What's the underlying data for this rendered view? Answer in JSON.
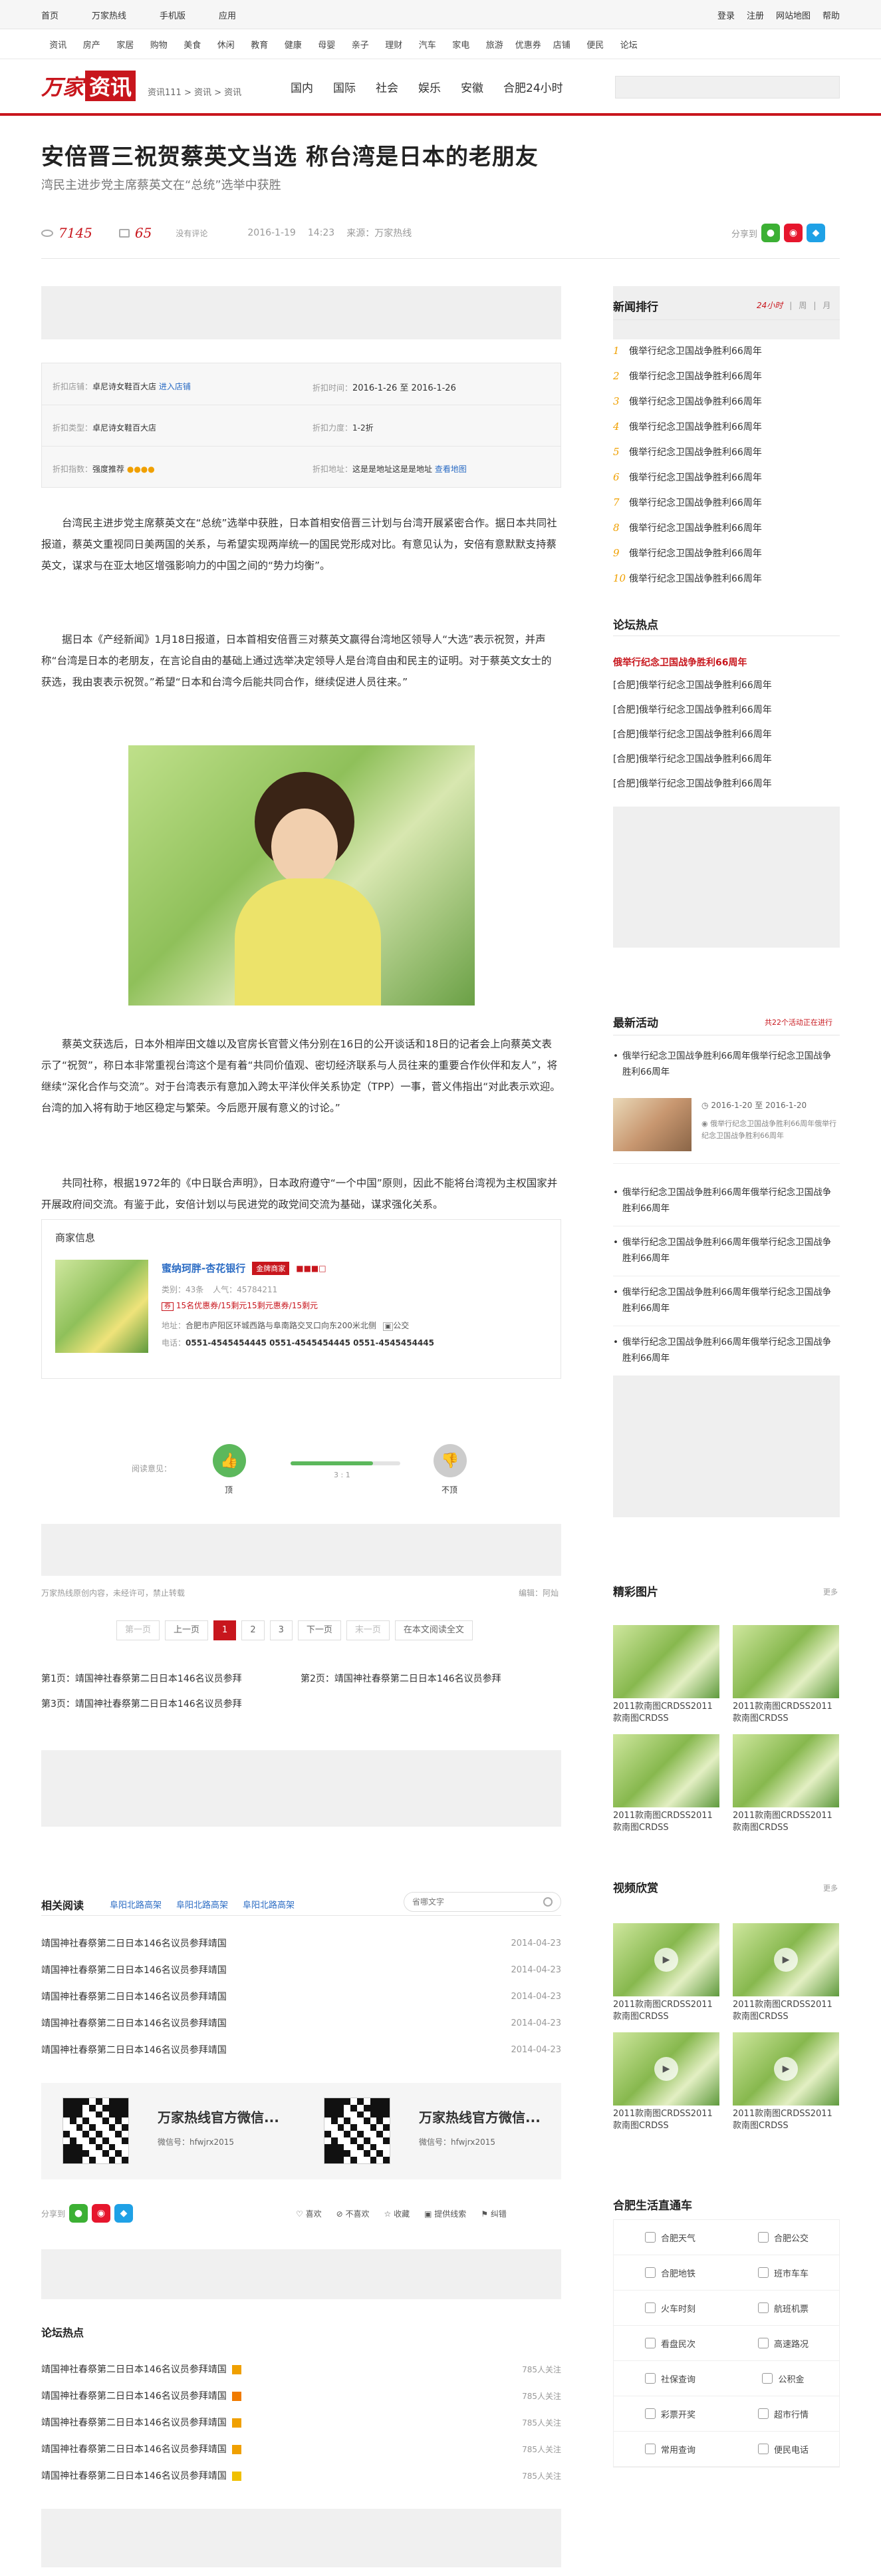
{
  "topbar": {
    "links": [
      "首页",
      "万家热线",
      "手机版",
      "应用"
    ],
    "right": [
      "登录",
      "注册",
      "网站地图",
      "帮助"
    ]
  },
  "channels": [
    "资讯",
    "房产",
    "家居",
    "购物",
    "美食",
    "休闲",
    "教育",
    "健康",
    "母婴",
    "亲子",
    "理财",
    "汽车",
    "家电",
    "旅游",
    "优惠券",
    "店铺",
    "便民",
    "论坛"
  ],
  "header": {
    "logo_a": "万家",
    "logo_b": "资讯",
    "crumb": "资讯111 > 资讯 > 资讯",
    "nav": [
      "国内",
      "国际",
      "社会",
      "娱乐",
      "安徽",
      "合肥24小时"
    ]
  },
  "article": {
    "title": "安倍晋三祝贺蔡英文当选 称台湾是日本的老朋友",
    "subtitle": "湾民主进步党主席蔡英文在“总统”选举中获胜",
    "views": "7145",
    "comments": "65",
    "comment_label": "没有评论",
    "date": "2016-1-19",
    "time": "14:23",
    "source": "来源：万家热线",
    "share_label": "分享到",
    "info": {
      "store_k": "折扣店铺：",
      "store_v": "卓尼诗女鞋百大店",
      "store_link": "进入店铺",
      "time_k": "折扣时间：",
      "time_v": "2016-1-26 至 2016-1-26",
      "type_k": "折扣类型：",
      "type_v": "卓尼诗女鞋百大店",
      "power_k": "折扣力度：",
      "power_v": "1-2折",
      "level_k": "折扣指数：",
      "level_v": "强度推荐",
      "addr_k": "折扣地址：",
      "addr_v": "这是是地址这是是地址",
      "map_link": "查看地图"
    },
    "p1": "台湾民主进步党主席蔡英文在“总统”选举中获胜，日本首相安倍晋三计划与台湾开展紧密合作。据日本共同社报道，蔡英文重视同日美两国的关系，与希望实现两岸统一的国民党形成对比。有意见认为，安倍有意默默支持蔡英文，谋求与在亚太地区增强影响力的中国之间的“势力均衡”。",
    "p2": "据日本《产经新闻》1月18日报道，日本首相安倍晋三对蔡英文赢得台湾地区领导人“大选”表示祝贺，并声称“台湾是日本的老朋友，在言论自由的基础上通过选举决定领导人是台湾自由和民主的证明。对于蔡英文女士的获选，我由衷表示祝贺。”希望“日本和台湾今后能共同合作，继续促进人员往来。”",
    "p3": "蔡英文获选后，日本外相岸田文雄以及官房长官菅义伟分别在16日的公开谈话和18日的记者会上向蔡英文表示了“祝贺”，称日本非常重视台湾这个是有着“共同价值观、密切经济联系与人员往来的重要合作伙伴和友人”，将继续“深化合作与交流”。对于台湾表示有意加入跨太平洋伙伴关系协定（TPP）一事，菅义伟指出“对此表示欢迎。台湾的加入将有助于地区稳定与繁荣。今后愿开展有意义的讨论。”",
    "p4": "共同社称，根据1972年的《中日联合声明》，日本政府遵守“一个中国”原则，因此不能将台湾视为主权国家并开展政府间交流。有鉴于此，安倍计划以与民进党的政党间交流为基础，谋求强化关系。"
  },
  "merchant": {
    "heading": "商家信息",
    "name": "蜜纳珂胖-杏花银行",
    "badge": "金牌商家",
    "cat_k": "类别：",
    "cat_v": "43条",
    "pop_k": "人气：",
    "pop_v": "45784211",
    "discount": "15名优惠券/15剩元15剩元惠券/15剩元",
    "addr_k": "地址：",
    "addr_v": "合肥市庐阳区环城西路与阜南路交叉口向东200米北侧",
    "bus": "公交",
    "tel_k": "电话：",
    "tel_v": "0551-4545454445 0551-4545454445 0551-4545454445"
  },
  "rating": {
    "label": "阅读意见：",
    "up": "顶",
    "down": "不顶",
    "ratio": "3 : 1",
    "up_share": 0.75
  },
  "note": {
    "left": "万家热线原创内容，未经许可，禁止转载",
    "editor": "编辑：阿灿"
  },
  "pager": {
    "first": "第一页",
    "prev": "上一页",
    "pages": [
      "1",
      "2",
      "3"
    ],
    "next": "下一页",
    "last": "末一页",
    "all": "在本文阅读全文"
  },
  "pagelinks": [
    "第1页：靖国神社春祭第二日日本146名议员参拜",
    "第2页：靖国神社春祭第二日日本146名议员参拜",
    "第3页：靖国神社春祭第二日日本146名议员参拜"
  ],
  "related": {
    "title": "相关阅读",
    "tags": [
      "阜阳北路高架",
      "阜阳北路高架",
      "阜阳北路高架"
    ],
    "search_placeholder": "省哪文字",
    "items": [
      {
        "t": "靖国神社春祭第二日日本146名议员参拜靖国",
        "d": "2014-04-23"
      },
      {
        "t": "靖国神社春祭第二日日本146名议员参拜靖国",
        "d": "2014-04-23"
      },
      {
        "t": "靖国神社春祭第二日日本146名议员参拜靖国",
        "d": "2014-04-23"
      },
      {
        "t": "靖国神社春祭第二日日本146名议员参拜靖国",
        "d": "2014-04-23"
      },
      {
        "t": "靖国神社春祭第二日日本146名议员参拜靖国",
        "d": "2014-04-23"
      }
    ]
  },
  "wechat": [
    {
      "name": "万家热线官方微信...",
      "id": "微信号：hfwjrx2015"
    },
    {
      "name": "万家热线官方微信...",
      "id": "微信号：hfwjrx2015"
    }
  ],
  "actions": {
    "share": "分享到",
    "items": [
      "喜欢",
      "不喜欢",
      "收藏",
      "提供线索",
      "纠错"
    ]
  },
  "forum_hot": {
    "title": "论坛热点",
    "items": [
      {
        "t": "靖国神社春祭第二日日本146名议员参拜靖国",
        "n": "785人关注"
      },
      {
        "t": "靖国神社春祭第二日日本146名议员参拜靖国",
        "n": "785人关注"
      },
      {
        "t": "靖国神社春祭第二日日本146名议员参拜靖国",
        "n": "785人关注"
      },
      {
        "t": "靖国神社春祭第二日日本146名议员参拜靖国",
        "n": "785人关注"
      },
      {
        "t": "靖国神社春祭第二日日本146名议员参拜靖国",
        "n": "785人关注"
      }
    ]
  },
  "sidebar": {
    "news_rank": {
      "title": "新闻排行",
      "tabs": [
        "24小时",
        "周",
        "月"
      ],
      "items": [
        "俄举行纪念卫国战争胜利66周年",
        "俄举行纪念卫国战争胜利66周年",
        "俄举行纪念卫国战争胜利66周年",
        "俄举行纪念卫国战争胜利66周年",
        "俄举行纪念卫国战争胜利66周年",
        "俄举行纪念卫国战争胜利66周年",
        "俄举行纪念卫国战争胜利66周年",
        "俄举行纪念卫国战争胜利66周年",
        "俄举行纪念卫国战争胜利66周年",
        "俄举行纪念卫国战争胜利66周年"
      ]
    },
    "forum": {
      "title": "论坛热点",
      "lead": "俄举行纪念卫国战争胜利66周年",
      "items": [
        "[合肥]俄举行纪念卫国战争胜利66周年",
        "[合肥]俄举行纪念卫国战争胜利66周年",
        "[合肥]俄举行纪念卫国战争胜利66周年",
        "[合肥]俄举行纪念卫国战争胜利66周年",
        "[合肥]俄举行纪念卫国战争胜利66周年"
      ]
    },
    "activity": {
      "title": "最新活动",
      "count_note": "共22个活动正在进行",
      "first": "俄举行纪念卫国战争胜利66周年俄举行纪念卫国战争胜利66周年",
      "date": "2016-1-20 至 2016-1-20",
      "desc": "俄举行纪念卫国战争胜利66周年俄举行纪念卫国战争胜利66周年",
      "items": [
        "俄举行纪念卫国战争胜利66周年俄举行纪念卫国战争胜利66周年",
        "俄举行纪念卫国战争胜利66周年俄举行纪念卫国战争胜利66周年",
        "俄举行纪念卫国战争胜利66周年俄举行纪念卫国战争胜利66周年",
        "俄举行纪念卫国战争胜利66周年俄举行纪念卫国战争胜利66周年"
      ]
    },
    "gallery": {
      "title": "精彩图片",
      "more": "更多",
      "caps": [
        "2011款南图CRDSS2011款南图CRDSS",
        "2011款南图CRDSS2011款南图CRDSS",
        "2011款南图CRDSS2011款南图CRDSS",
        "2011款南图CRDSS2011款南图CRDSS"
      ]
    },
    "video": {
      "title": "视频欣赏",
      "more": "更多",
      "caps": [
        "2011款南图CRDSS2011款南图CRDSS",
        "2011款南图CRDSS2011款南图CRDSS",
        "2011款南图CRDSS2011款南图CRDSS",
        "2011款南图CRDSS2011款南图CRDSS"
      ]
    },
    "services": {
      "title": "合肥生活直通车",
      "items": [
        "合肥天气",
        "合肥公交",
        "合肥地铁",
        "班市车车",
        "火车时刻",
        "航班机票",
        "看盘民次",
        "高速路况",
        "社保查询",
        "公积金",
        "彩票开奖",
        "超市行情",
        "常用查询",
        "便民电话"
      ]
    }
  },
  "colors": {
    "brand_red": "#c8161d",
    "accent_orange": "#f0a000",
    "link_blue": "#2b6cc4",
    "wechat_green": "#3cb034",
    "weibo_red": "#e6162d",
    "qq_blue": "#1fa1e6",
    "up_green": "#5cb85c"
  }
}
